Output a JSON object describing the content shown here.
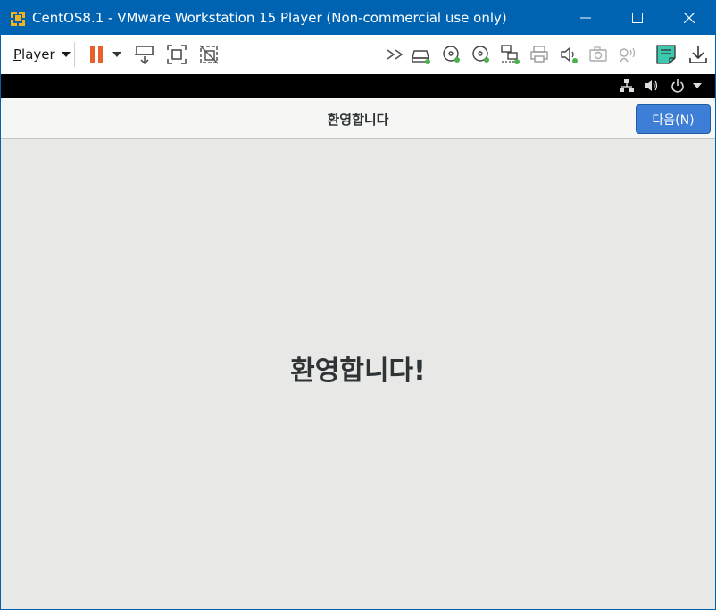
{
  "window": {
    "title": "CentOS8.1 - VMware Workstation 15 Player (Non-commercial use only)"
  },
  "colors": {
    "titlebar": "#0063b1",
    "pause_accent": "#e8612c",
    "device_active": "#4caf50",
    "note_icon": "#3cc7b0",
    "next_button": "#3d7fd6"
  },
  "toolbar": {
    "player_menu_label": "Player",
    "player_menu_mnemonic": "P",
    "player_menu_rest": "layer",
    "icons": [
      "pause-icon",
      "send-ctrl-alt-del-icon",
      "fit-guest-icon",
      "unity-disabled-icon",
      "forward-icon",
      "hard-disk-icon",
      "cd-dvd-icon",
      "cd-dvd-2-icon",
      "network-adapter-icon",
      "printer-icon",
      "sound-card-icon",
      "camera-icon",
      "usb-audio-icon",
      "notes-icon",
      "download-icon"
    ]
  },
  "vm_status": {
    "icons": [
      "network-status-icon",
      "volume-icon",
      "power-icon",
      "dropdown-arrow-icon"
    ]
  },
  "guest": {
    "header_title": "환영합니다",
    "next_button_label": "다음(N)",
    "welcome_text": "환영합니다!"
  }
}
